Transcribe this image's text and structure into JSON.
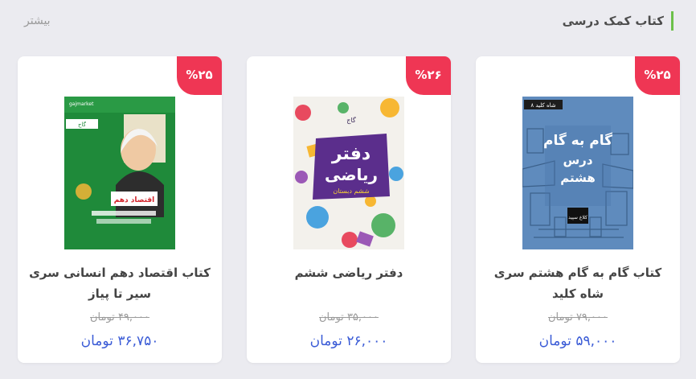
{
  "section": {
    "title": "کتاب کمک درسی",
    "more_label": "بیشتر"
  },
  "products": [
    {
      "discount": "%۲۵",
      "title": "کتاب گام به گام هشتم سری شاه کلید",
      "old_price": "۷۹,۰۰۰ تومان",
      "new_price": "۵۹,۰۰۰ تومان",
      "cover": {
        "series": "شاه کلید ۸",
        "line1": "گام به گام",
        "line2": "درس",
        "line3": "هشتم",
        "publisher": "کلاغ سپید"
      }
    },
    {
      "discount": "%۲۶",
      "title": "دفتر ریاضی ششم",
      "old_price": "۳۵,۰۰۰ تومان",
      "new_price": "۲۶,۰۰۰ تومان",
      "cover": {
        "publisher": "گاج",
        "line1": "دفتر",
        "line2": "ریاضی",
        "line3": "ششم دبستان"
      }
    },
    {
      "discount": "%۲۵",
      "title": "کتاب اقتصاد دهم انسانی سری سیر تا پیاز",
      "old_price": "۴۹,۰۰۰ تومان",
      "new_price": "۳۶,۷۵۰ تومان",
      "cover": {
        "brand": "gajmarket",
        "publisher": "گاج",
        "label": "اقتصاد دهم"
      }
    }
  ]
}
